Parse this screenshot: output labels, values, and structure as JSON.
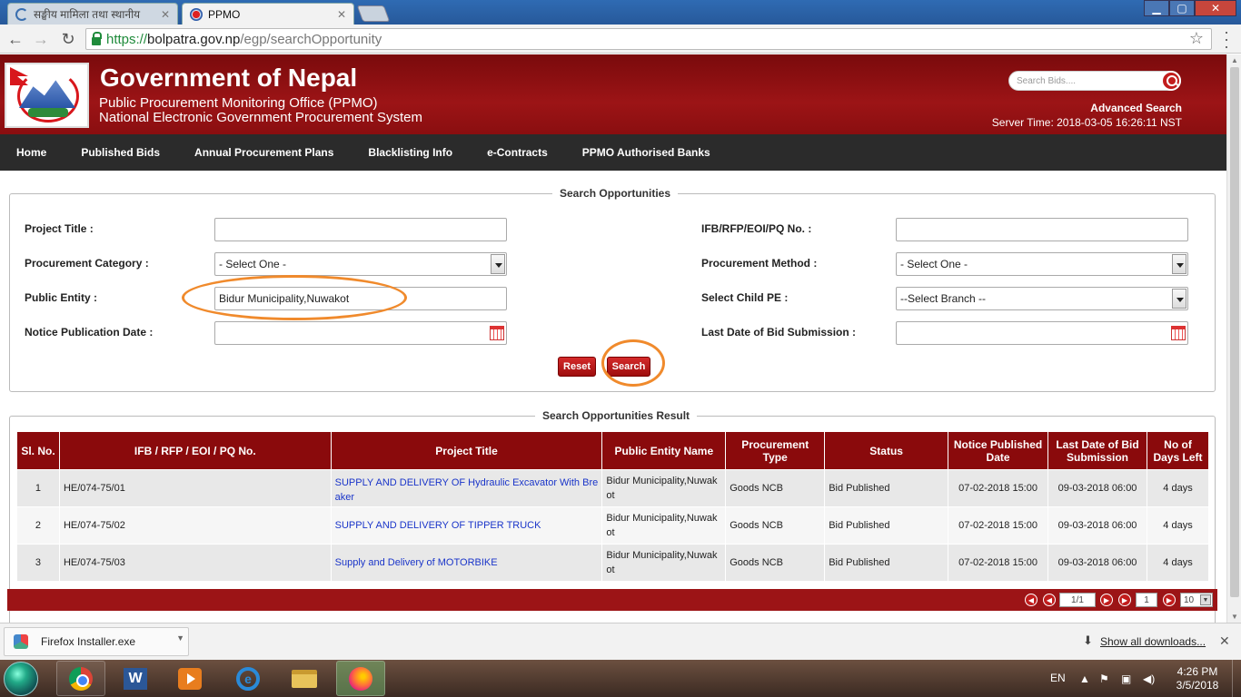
{
  "browser": {
    "tabs": [
      {
        "title": "सङ्घीय मामिला तथा स्थानीय",
        "active": false
      },
      {
        "title": "PPMO",
        "active": true
      }
    ],
    "url": {
      "scheme": "https://",
      "host": "bolpatra.gov.np",
      "path": "/egp/searchOpportunity"
    }
  },
  "header": {
    "title": "Government of Nepal",
    "subtitle1": "Public Procurement Monitoring Office (PPMO)",
    "subtitle2": "National Electronic Government Procurement System",
    "search_placeholder": "Search Bids....",
    "advanced_search": "Advanced Search",
    "server_time": "Server Time: 2018-03-05 16:26:11 NST"
  },
  "nav": [
    "Home",
    "Published Bids",
    "Annual Procurement Plans",
    "Blacklisting Info",
    "e-Contracts",
    "PPMO Authorised Banks"
  ],
  "search": {
    "legend": "Search Opportunities",
    "project_title_label": "Project Title :",
    "project_title_value": "",
    "ifb_label": "IFB/RFP/EOI/PQ No. :",
    "ifb_value": "",
    "category_label": "Procurement Category :",
    "category_value": "- Select One -",
    "method_label": "Procurement Method :",
    "method_value": "- Select One -",
    "public_entity_label": "Public Entity :",
    "public_entity_value": "Bidur Municipality,Nuwakot",
    "child_pe_label": "Select Child PE :",
    "child_pe_value": "--Select Branch --",
    "notice_date_label": "Notice Publication Date :",
    "last_date_label": "Last Date of Bid Submission :",
    "reset_label": "Reset",
    "search_label": "Search"
  },
  "results": {
    "legend": "Search Opportunities Result",
    "columns": [
      "Sl. No.",
      "IFB / RFP / EOI / PQ No.",
      "Project Title",
      "Public Entity Name",
      "Procurement Type",
      "Status",
      "Notice Published Date",
      "Last Date of Bid Submission",
      "No of Days Left"
    ],
    "rows": [
      {
        "sl": "1",
        "ifb": "HE/074-75/01",
        "title": "SUPPLY AND DELIVERY OF Hydraulic Excavator With Breaker",
        "entity": "Bidur Municipality,Nuwakot",
        "type": "Goods  NCB",
        "status": "Bid Published",
        "notice": "07-02-2018 15:00",
        "last": "09-03-2018 06:00",
        "days": "4 days"
      },
      {
        "sl": "2",
        "ifb": "HE/074-75/02",
        "title": "SUPPLY AND DELIVERY OF TIPPER TRUCK",
        "entity": "Bidur Municipality,Nuwakot",
        "type": "Goods  NCB",
        "status": "Bid Published",
        "notice": "07-02-2018 15:00",
        "last": "09-03-2018 06:00",
        "days": "4 days"
      },
      {
        "sl": "3",
        "ifb": "HE/074-75/03",
        "title": "Supply and Delivery of MOTORBIKE",
        "entity": "Bidur Municipality,Nuwakot",
        "type": "Goods  NCB",
        "status": "Bid Published",
        "notice": "07-02-2018 15:00",
        "last": "09-03-2018 06:00",
        "days": "4 days"
      }
    ],
    "pager": {
      "page_info": "1/1",
      "page_input": "1",
      "page_size": "10"
    }
  },
  "downloads": {
    "file": "Firefox Installer.exe",
    "show_all": "Show all downloads..."
  },
  "taskbar": {
    "lang": "EN",
    "time": "4:26 PM",
    "date": "3/5/2018"
  },
  "colors": {
    "brand_red": "#9c1416",
    "nav_dark": "#2b2b2b",
    "highlight": "#f08a2c",
    "link_blue": "#1a35c9"
  }
}
